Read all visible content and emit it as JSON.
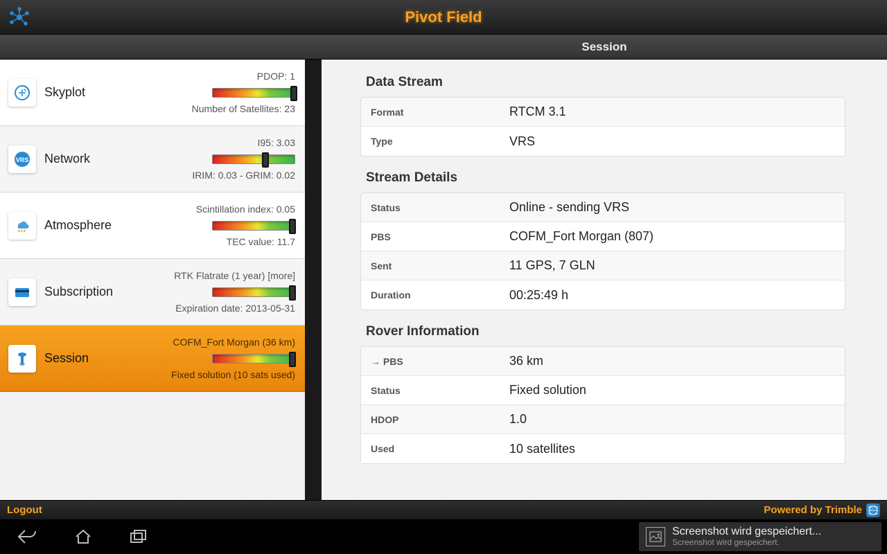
{
  "header": {
    "title": "Pivot Field",
    "section": "Session"
  },
  "sidebar": {
    "items": [
      {
        "label": "Skyplot",
        "top": "PDOP: 1",
        "bottom": "Number of Satellites: 23",
        "thumb": 95
      },
      {
        "label": "Network",
        "top": "I95: 3.03",
        "bottom": "IRIM: 0.03 - GRIM: 0.02",
        "thumb": 60
      },
      {
        "label": "Atmosphere",
        "top": "Scintillation index: 0.05",
        "bottom": "TEC value: 11.7",
        "thumb": 93
      },
      {
        "label": "Subscription",
        "top": "RTK Flatrate (1 year) [more]",
        "bottom": "Expiration date: 2013-05-31",
        "thumb": 93
      },
      {
        "label": "Session",
        "top": "COFM_Fort Morgan (36 km)",
        "bottom": "Fixed solution (10 sats used)",
        "thumb": 93
      }
    ]
  },
  "content": {
    "data_stream": {
      "title": "Data Stream",
      "rows": [
        {
          "k": "Format",
          "v": "RTCM 3.1"
        },
        {
          "k": "Type",
          "v": "VRS"
        }
      ]
    },
    "stream_details": {
      "title": "Stream Details",
      "rows": [
        {
          "k": "Status",
          "v": "Online - sending VRS"
        },
        {
          "k": "PBS",
          "v": "COFM_Fort Morgan (807)"
        },
        {
          "k": "Sent",
          "v": "11 GPS, 7 GLN"
        },
        {
          "k": "Duration",
          "v": "00:25:49 h"
        }
      ]
    },
    "rover_info": {
      "title": "Rover Information",
      "rows": [
        {
          "k": "→ PBS",
          "v": "36 km"
        },
        {
          "k": "Status",
          "v": "Fixed solution"
        },
        {
          "k": "HDOP",
          "v": "1.0"
        },
        {
          "k": "Used",
          "v": "10 satellites"
        }
      ]
    }
  },
  "footer": {
    "logout": "Logout",
    "powered": "Powered by Trimble"
  },
  "toast": {
    "title": "Screenshot wird gespeichert...",
    "subtitle": "Screenshot wird gespeichert."
  }
}
